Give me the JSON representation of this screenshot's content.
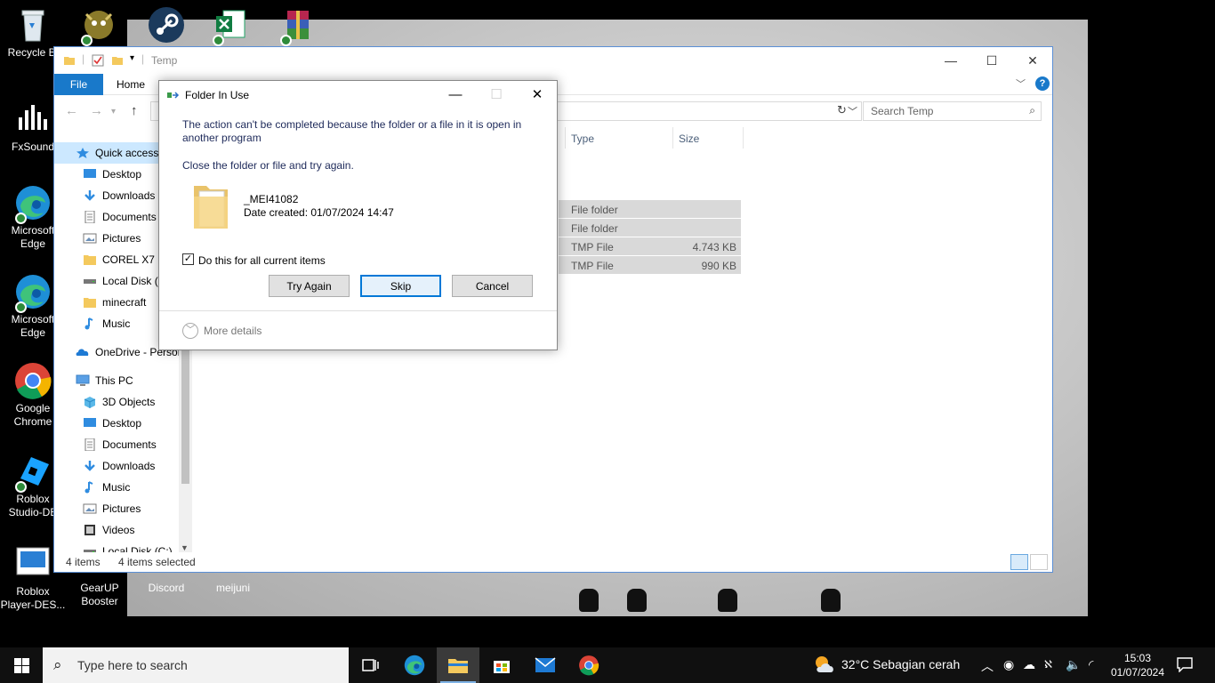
{
  "desktop": {
    "icons": [
      {
        "label": "Recycle Bi"
      },
      {
        "label": "FxSound"
      },
      {
        "label": "Microsoft Edge"
      },
      {
        "label": "Microsoft Edge"
      },
      {
        "label": "Google Chrome"
      },
      {
        "label": "Roblox Studio-DE"
      },
      {
        "label": "Roblox Player-DES..."
      },
      {
        "label": "GearUP Booster"
      },
      {
        "label": "Discord"
      },
      {
        "label": "meijuni"
      }
    ]
  },
  "explorer": {
    "title": "Temp",
    "tabs": {
      "file": "File",
      "home": "Home"
    },
    "search_placeholder": "Search Temp",
    "columns": {
      "type": "Type",
      "size": "Size"
    },
    "nav": {
      "quick_access": "Quick access",
      "qa_items": [
        "Desktop",
        "Downloads",
        "Documents",
        "Pictures",
        "COREL X7",
        "Local Disk (D",
        "minecraft",
        "Music"
      ],
      "onedrive": "OneDrive - Persor",
      "this_pc": "This PC",
      "pc_items": [
        "3D Objects",
        "Desktop",
        "Documents",
        "Downloads",
        "Music",
        "Pictures",
        "Videos",
        "Local Disk (C:)"
      ]
    },
    "files": [
      {
        "type": "File folder",
        "size": ""
      },
      {
        "type": "File folder",
        "size": ""
      },
      {
        "type": "TMP File",
        "size": "4.743 KB"
      },
      {
        "type": "TMP File",
        "size": "990 KB"
      }
    ],
    "status": {
      "count": "4 items",
      "selected": "4 items selected"
    }
  },
  "dialog": {
    "title": "Folder In Use",
    "message": "The action can't be completed because the folder or a file in it is open in another program",
    "sub": "Close the folder or file and try again.",
    "file_name": "_MEI41082",
    "file_date": "Date created: 01/07/2024 14:47",
    "checkbox_label": "Do this for all current items",
    "checkbox_checked": true,
    "buttons": {
      "try_again": "Try Again",
      "skip": "Skip",
      "cancel": "Cancel"
    },
    "more_details": "More details"
  },
  "taskbar": {
    "search_placeholder": "Type here to search",
    "weather": "32°C  Sebagian cerah",
    "time": "15:03",
    "date": "01/07/2024"
  },
  "colors": {
    "accent": "#1979ca",
    "selection": "#cce8ff",
    "taskbar": "#101010"
  }
}
